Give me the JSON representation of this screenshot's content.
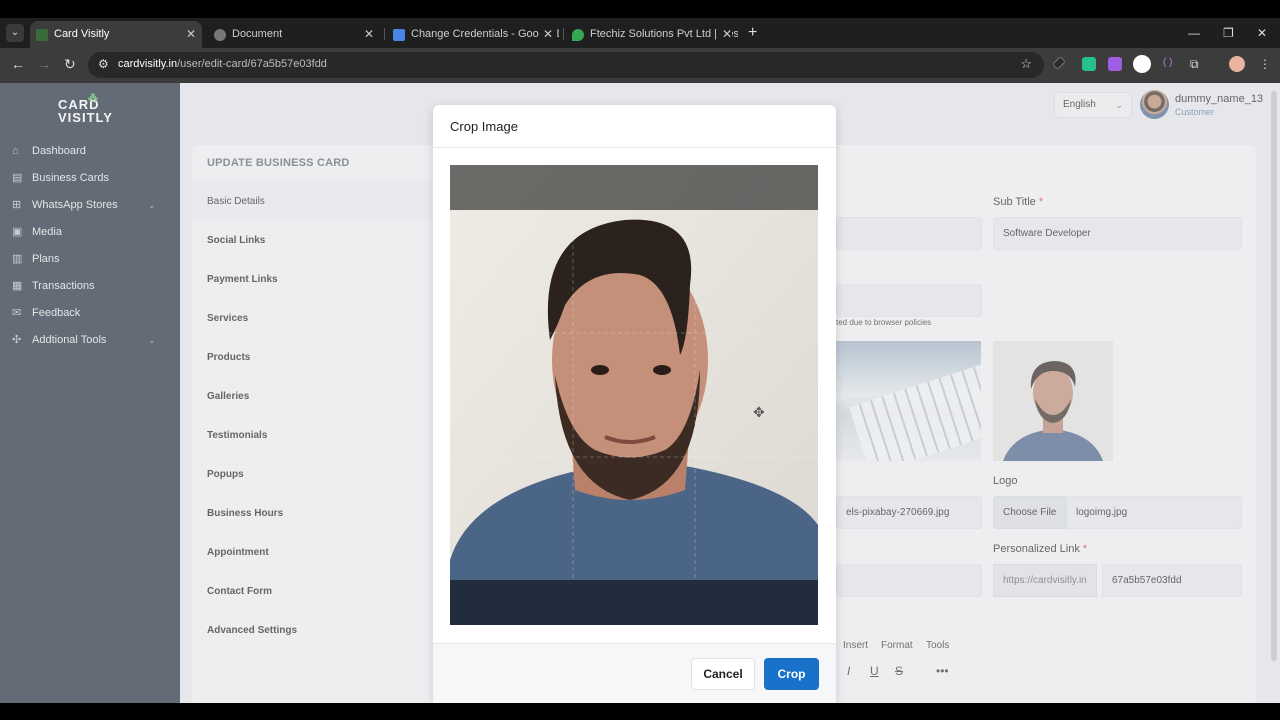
{
  "browser": {
    "tabs": [
      {
        "title": "Card Visitly",
        "active": true
      },
      {
        "title": "Document",
        "active": false
      },
      {
        "title": "Change Credentials - Google Do",
        "active": false
      },
      {
        "title": "Ftechiz Solutions Pvt Ltd | Best",
        "active": false
      }
    ],
    "url_host": "cardvisitly.in",
    "url_path": "/user/edit-card/67a5b57e03fdd"
  },
  "app": {
    "logo_line1": "CARD",
    "logo_line2": "VISITLY",
    "nav": [
      {
        "label": "Dashboard",
        "icon": "dashboard-icon"
      },
      {
        "label": "Business Cards",
        "icon": "card-icon"
      },
      {
        "label": "WhatsApp Stores",
        "icon": "store-icon"
      },
      {
        "label": "Media",
        "icon": "media-icon"
      },
      {
        "label": "Plans",
        "icon": "plans-icon"
      },
      {
        "label": "Transactions",
        "icon": "transactions-icon"
      },
      {
        "label": "Feedback",
        "icon": "feedback-icon"
      },
      {
        "label": "Addtional Tools",
        "icon": "tools-icon"
      }
    ],
    "language": "English",
    "user_name": "dummy_name_13",
    "user_role": "Customer"
  },
  "editor": {
    "title": "UPDATE BUSINESS CARD",
    "sections": [
      "Basic Details",
      "Social Links",
      "Payment Links",
      "Services",
      "Products",
      "Galleries",
      "Testimonials",
      "Popups",
      "Business Hours",
      "Appointment",
      "Contact Form",
      "Advanced Settings"
    ],
    "sub_title_label": "Sub Title",
    "sub_title_value": "Software Developer",
    "hint_fragment": "ted due to browser policies",
    "file_fragment": "els-pixabay-270669.jpg",
    "logo_label": "Logo",
    "choose_file": "Choose File",
    "logo_file": "logoimg.jpg",
    "personalized_link_label": "Personalized Link",
    "link_prefix": "https://cardvisitly.in",
    "link_slug": "67a5b57e03fdd",
    "editor_menu": [
      "Insert",
      "Format",
      "Tools"
    ],
    "editor_tools": [
      "I",
      "U",
      "S",
      "•••"
    ]
  },
  "modal": {
    "title": "Crop Image",
    "cancel": "Cancel",
    "crop": "Crop"
  },
  "colors": {
    "sidebar": "#1f2c3b",
    "primary": "#1872c9",
    "required": "#d3342c"
  }
}
